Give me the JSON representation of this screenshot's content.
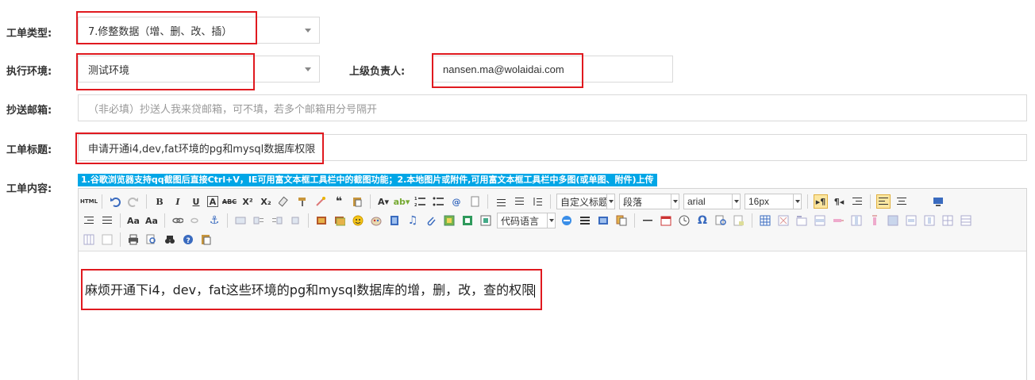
{
  "form": {
    "ticket_type_label": "工单类型:",
    "ticket_type_value": "7.修整数据（增、删、改、插）",
    "env_label": "执行环境:",
    "env_value": "测试环境",
    "supervisor_label": "上级负责人:",
    "supervisor_value": "nansen.ma@wolaidai.com",
    "cc_label": "抄送邮箱:",
    "cc_placeholder": "（非必填）抄送人我来贷邮箱，可不填，若多个邮箱用分号隔开",
    "title_label": "工单标题:",
    "title_value": "申请开通i4,dev,fat环境的pg和mysql数据库权限",
    "content_label": "工单内容:"
  },
  "editor": {
    "banner": "1.谷歌浏览器支持qq截图后直接Ctrl+V，IE可用富文本框工具栏中的截图功能；2.本地图片或附件,可用富文本框工具栏中多图(或单图、附件)上传",
    "toolbar": {
      "html_label": "HTML",
      "custom_title": "自定义标题",
      "paragraph": "段落",
      "font_family": "arial",
      "font_size": "16px",
      "code_language": "代码语言"
    },
    "content_text": "麻烦开通下i4，dev，fat这些环境的pg和mysql数据库的增，删，改，查的权限"
  },
  "colors": {
    "highlight_box": "#e0191f",
    "banner_bg": "#00a6e6"
  }
}
